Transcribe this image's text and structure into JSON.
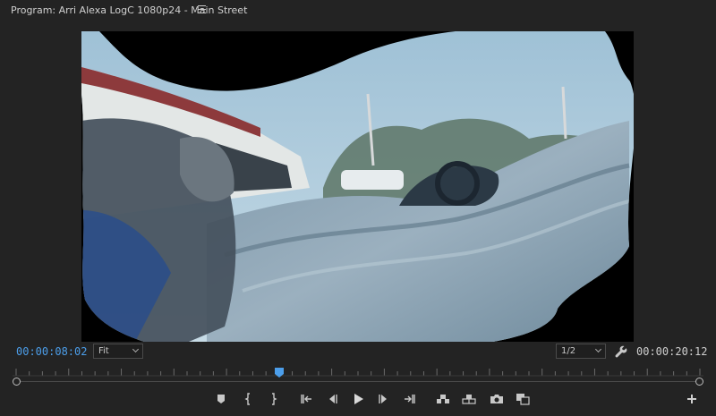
{
  "panel": {
    "title": "Program: Arri Alexa LogC 1080p24 - Main Street"
  },
  "timecodes": {
    "current": "00:00:08:02",
    "duration": "00:00:20:12"
  },
  "controls": {
    "zoom": "Fit",
    "resolution": "1/2"
  },
  "timeline": {
    "playhead_fraction": 0.385
  },
  "colors": {
    "accent_blue": "#4c9eea",
    "background": "#232323",
    "icon": "#c8c8c8"
  },
  "icons": [
    "panel-menu-icon",
    "wrench-icon",
    "add-marker-icon",
    "mark-in-icon",
    "mark-out-icon",
    "go-to-in-icon",
    "step-back-icon",
    "play-icon",
    "step-forward-icon",
    "go-to-out-icon",
    "insert-icon",
    "overwrite-icon",
    "export-frame-icon",
    "comparison-view-icon",
    "add-button-icon"
  ]
}
